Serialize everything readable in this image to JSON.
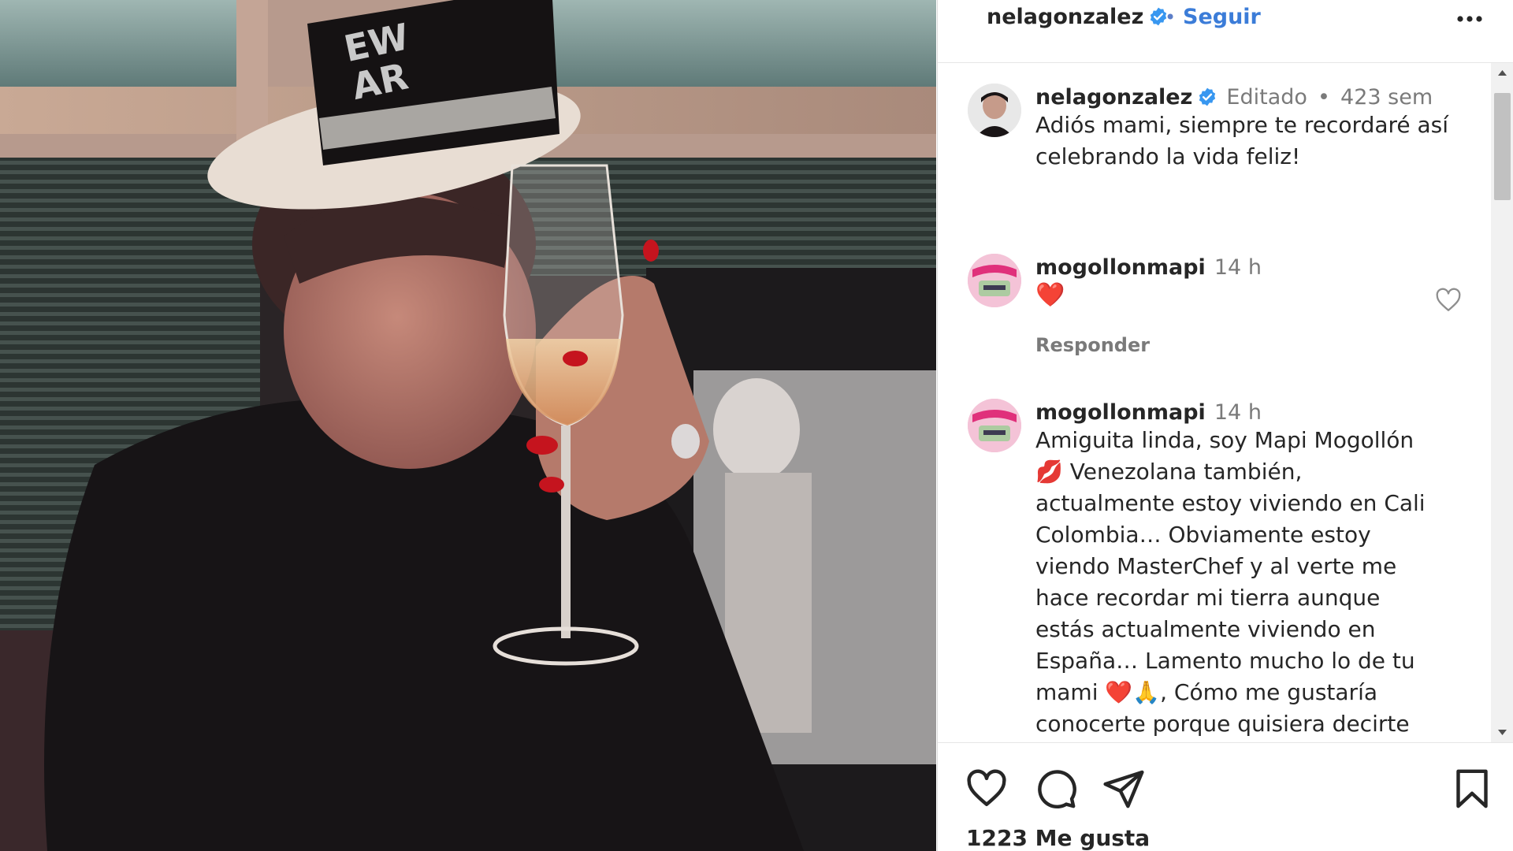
{
  "post": {
    "username": "nelagonzalez",
    "separator": "•",
    "follow_label": "Seguir",
    "more_icon": "more-horizontal-icon"
  },
  "caption": {
    "username": "nelagonzalez",
    "edited": "Editado",
    "separator": "•",
    "time": "423 sem",
    "text_line1": "Adiós mami, siempre te recordaré así",
    "text_line2": "celebrando la vida feliz!"
  },
  "comments": [
    {
      "username": "mogollonmapi",
      "time": "14 h",
      "text": "❤️",
      "reply_label": "Responder"
    },
    {
      "username": "mogollonmapi",
      "time": "14 h",
      "lines": [
        "Amiguita linda, soy Mapi Mogollón",
        "💋 Venezolana también,",
        "actualmente estoy viviendo en Cali",
        "Colombia… Obviamente estoy",
        "viendo MasterChef y al verte me",
        "hace recordar mi tierra aunque",
        "estás actualmente viviendo en",
        "España… Lamento mucho lo de tu",
        "mami ❤️🙏, Cómo me gustaría",
        "conocerte porque quisiera decirte"
      ]
    }
  ],
  "footer": {
    "likes": "1223 Me gusta"
  },
  "colors": {
    "accent": "#3b7cd8",
    "verified": "#3897f0",
    "heart": "#e0142d"
  }
}
